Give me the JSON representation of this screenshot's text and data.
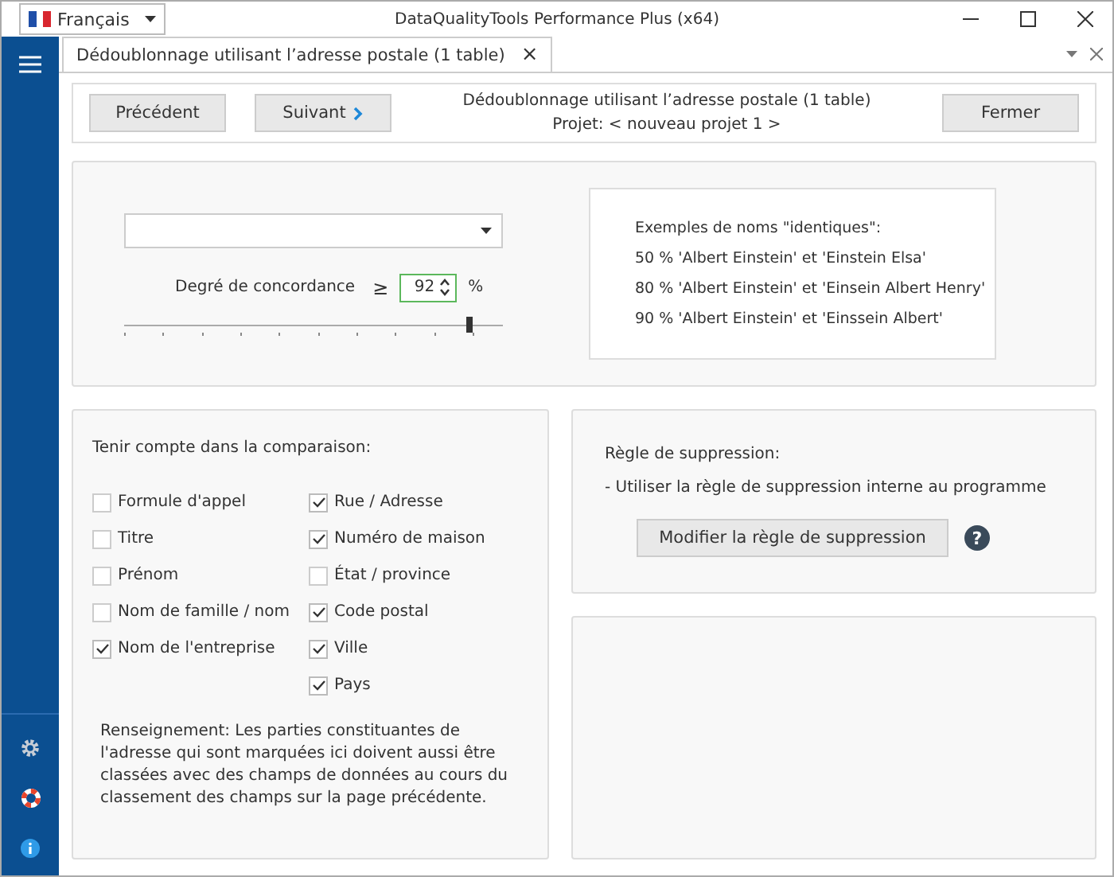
{
  "window": {
    "title": "DataQualityTools Performance Plus (x64)",
    "language": "Français"
  },
  "tab": {
    "label": "Dédoublonnage utilisant l’adresse postale (1 table)",
    "close": "×"
  },
  "toolbar": {
    "back": "Précédent",
    "next": "Suivant",
    "title": "Dédoublonnage utilisant l’adresse postale (1 table)",
    "project": "Projet: < nouveau projet 1 >",
    "close": "Fermer"
  },
  "match": {
    "label": "Degré de concordance",
    "symbol": "≥",
    "value": "92",
    "unit": "%",
    "level": 0.91
  },
  "examples": {
    "title": "Exemples de noms \"identiques\":",
    "lines": [
      "50 %  'Albert Einstein' et 'Einstein Elsa'",
      "80 %  'Albert Einstein' et 'Einsein Albert Henry'",
      "90 %  'Albert Einstein' et 'Einssein Albert'"
    ]
  },
  "compare": {
    "title": "Tenir compte dans la comparaison:",
    "columns": [
      [
        {
          "label": "Formule d'appel",
          "checked": false
        },
        {
          "label": "Titre",
          "checked": false
        },
        {
          "label": "Prénom",
          "checked": false
        },
        {
          "label": "Nom de famille / nom",
          "checked": false
        },
        {
          "label": "Nom de l'entreprise",
          "checked": true
        }
      ],
      [
        {
          "label": "Rue / Adresse",
          "checked": true
        },
        {
          "label": "Numéro de maison",
          "checked": true
        },
        {
          "label": "État / province",
          "checked": false
        },
        {
          "label": "Code postal",
          "checked": true
        },
        {
          "label": "Ville",
          "checked": true
        },
        {
          "label": "Pays",
          "checked": true
        }
      ]
    ],
    "note": "Renseignement: Les parties constituantes de l'adresse qui sont marquées ici doivent aussi être classées avec des champs de données au cours du classement des champs sur la page précédente."
  },
  "suppression": {
    "title": "Règle de suppression:",
    "rule": "- Utiliser la règle de suppression interne au programme",
    "button": "Modifier la règle de suppression",
    "help": "?"
  }
}
